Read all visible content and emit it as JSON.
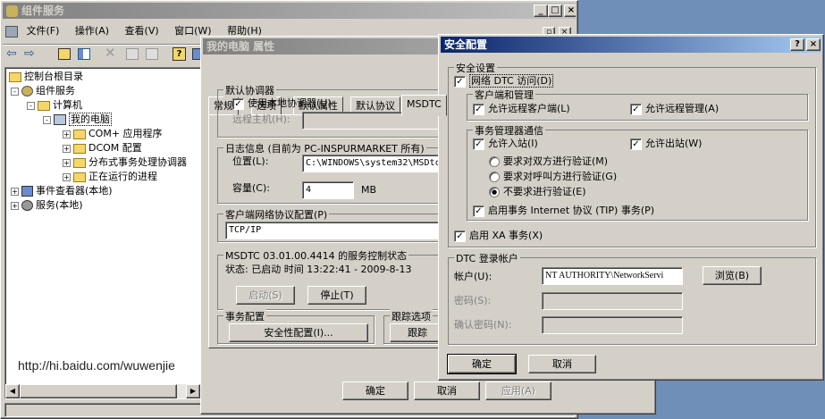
{
  "main_window": {
    "title": "组件服务",
    "menus": [
      "文件(F)",
      "操作(A)",
      "查看(V)",
      "窗口(W)",
      "帮助(H)"
    ],
    "caption_buttons": [
      "_",
      "□",
      "×"
    ]
  },
  "tree": {
    "items": [
      {
        "label": "控制台根目录",
        "icon": "folder-icon",
        "toggle": "-"
      },
      {
        "label": "组件服务",
        "icon": "component-services-icon",
        "toggle": "-"
      },
      {
        "label": "计算机",
        "icon": "folder-icon",
        "toggle": "-"
      },
      {
        "label": "我的电脑",
        "icon": "computer-icon",
        "toggle": "-"
      },
      {
        "label": "COM+ 应用程序",
        "icon": "folder-icon",
        "toggle": "+"
      },
      {
        "label": "DCOM 配置",
        "icon": "folder-icon",
        "toggle": "+"
      },
      {
        "label": "分布式事务处理协调器",
        "icon": "folder-icon",
        "toggle": "+"
      },
      {
        "label": "正在运行的进程",
        "icon": "folder-icon",
        "toggle": "+"
      },
      {
        "label": "事件查看器(本地)",
        "icon": "event-viewer-icon",
        "toggle": "+"
      },
      {
        "label": "服务(本地)",
        "icon": "services-icon",
        "toggle": "+"
      }
    ]
  },
  "watermark": "http://hi.baidu.com/wuwenjie",
  "props": {
    "title": "我的电脑 属性",
    "tabs": [
      "常规",
      "选项",
      "默认属性",
      "默认协议",
      "MSDTC"
    ],
    "default_coord": {
      "label": "默认协调器",
      "use_local": "使用本地协调器(U)",
      "remote_host_label": "远程主机(H):"
    },
    "log": {
      "label": "日志信息 (目前为 PC-INSPURMARKET 所有)",
      "location_label": "位置(L):",
      "location_value": "C:\\WINDOWS\\system32\\MSDtc",
      "size_label": "容量(C):",
      "size_value": "4",
      "size_unit": "MB"
    },
    "client_proto": {
      "label": "客户端网络协议配置(P)",
      "value": "TCP/IP"
    },
    "service": {
      "label": "MSDTC 03.01.00.4414 的服务控制状态",
      "status": "状态: 已启动 时间 13:22:41 - 2009-8-13",
      "start": "启动(S)",
      "stop": "停止(T)"
    },
    "txn_config": {
      "label": "事务配置",
      "security_button": "安全性配置(I)..."
    },
    "trace": {
      "label": "跟踪选项",
      "button": "跟踪"
    },
    "ok": "确定",
    "cancel": "取消",
    "apply": "应用(A)"
  },
  "sec": {
    "title": "安全配置",
    "help": "?",
    "close": "×",
    "settings_label": "安全设置",
    "network_dtc": "网络 DTC 访问(D)",
    "client_admin": {
      "label": "客户端和管理",
      "allow_remote_clients": "允许远程客户端(L)",
      "allow_remote_admin": "允许远程管理(A)"
    },
    "txm": {
      "label": "事务管理器通信",
      "allow_inbound": "允许入站(I)",
      "allow_outbound": "允许出站(W)",
      "mutual_auth": "要求对双方进行验证(M)",
      "caller_auth": "要求对呼叫方进行验证(G)",
      "no_auth": "不要求进行验证(E)",
      "tip": "启用事务 Internet 协议 (TIP) 事务(P)"
    },
    "xa": "启用 XA 事务(X)",
    "logon": {
      "label": "DTC 登录帐户",
      "account_label": "帐户(U):",
      "account_value": "NT AUTHORITY\\NetworkServi",
      "browse": "浏览(B)",
      "password_label": "密码(S):",
      "confirm_label": "确认密码(N):"
    },
    "ok": "确定",
    "cancel": "取消"
  }
}
